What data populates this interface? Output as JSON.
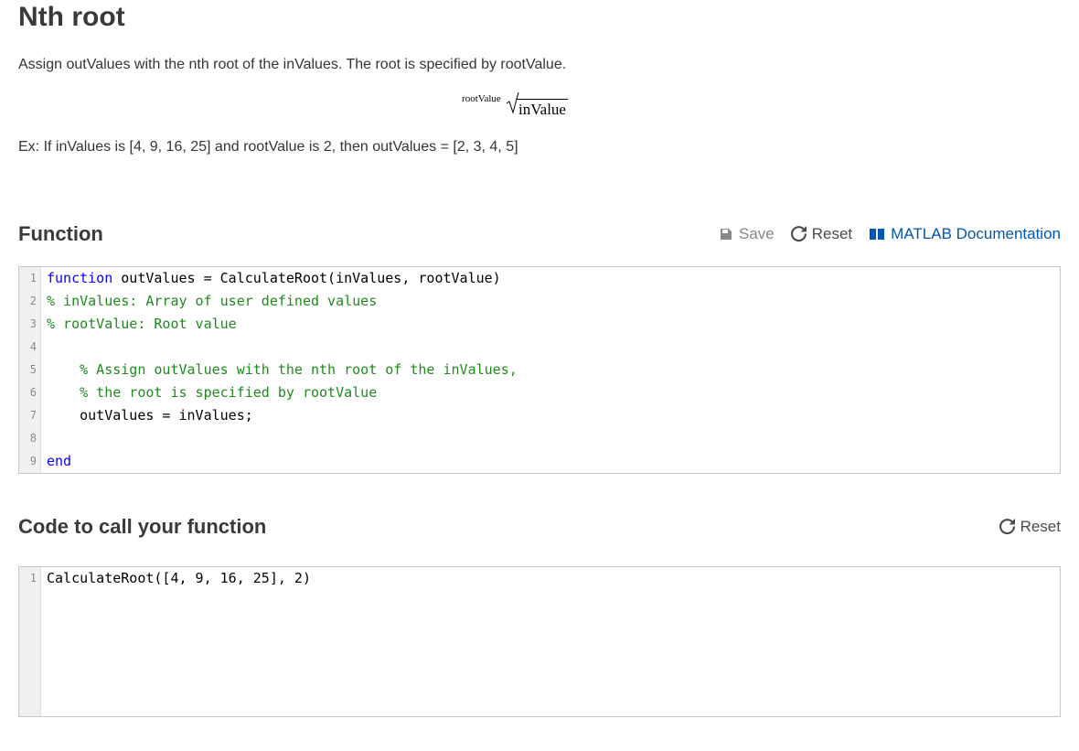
{
  "problem": {
    "title": "Nth root",
    "description": "Assign outValues with the nth root of the inValues. The root is specified by rootValue.",
    "formula_index": "rootValue",
    "formula_radicand": "inValue",
    "example": "Ex: If inValues is [4, 9, 16, 25] and rootValue is 2, then outValues = [2, 3, 4, 5]"
  },
  "function_section": {
    "heading": "Function",
    "save_label": "Save",
    "reset_label": "Reset",
    "doc_label": "MATLAB Documentation"
  },
  "function_code": {
    "lines": [
      [
        {
          "t": "function",
          "c": "kw"
        },
        {
          "t": " outValues = CalculateRoot(inValues, rootValue)",
          "c": ""
        }
      ],
      [
        {
          "t": "% inValues: Array of user defined values",
          "c": "cm"
        }
      ],
      [
        {
          "t": "% rootValue: Root value",
          "c": "cm"
        }
      ],
      [
        {
          "t": "",
          "c": ""
        }
      ],
      [
        {
          "t": "    ",
          "c": ""
        },
        {
          "t": "% Assign outValues with the nth root of the inValues,",
          "c": "cm"
        }
      ],
      [
        {
          "t": "    ",
          "c": ""
        },
        {
          "t": "% the root is specified by rootValue",
          "c": "cm"
        }
      ],
      [
        {
          "t": "    outValues = inValues;",
          "c": ""
        }
      ],
      [
        {
          "t": "",
          "c": ""
        }
      ],
      [
        {
          "t": "end",
          "c": "kw"
        }
      ]
    ]
  },
  "call_section": {
    "heading": "Code to call your function",
    "reset_label": "Reset"
  },
  "call_code": {
    "lines": [
      [
        {
          "t": "CalculateRoot([4, 9, 16, 25], 2)",
          "c": ""
        }
      ]
    ]
  }
}
